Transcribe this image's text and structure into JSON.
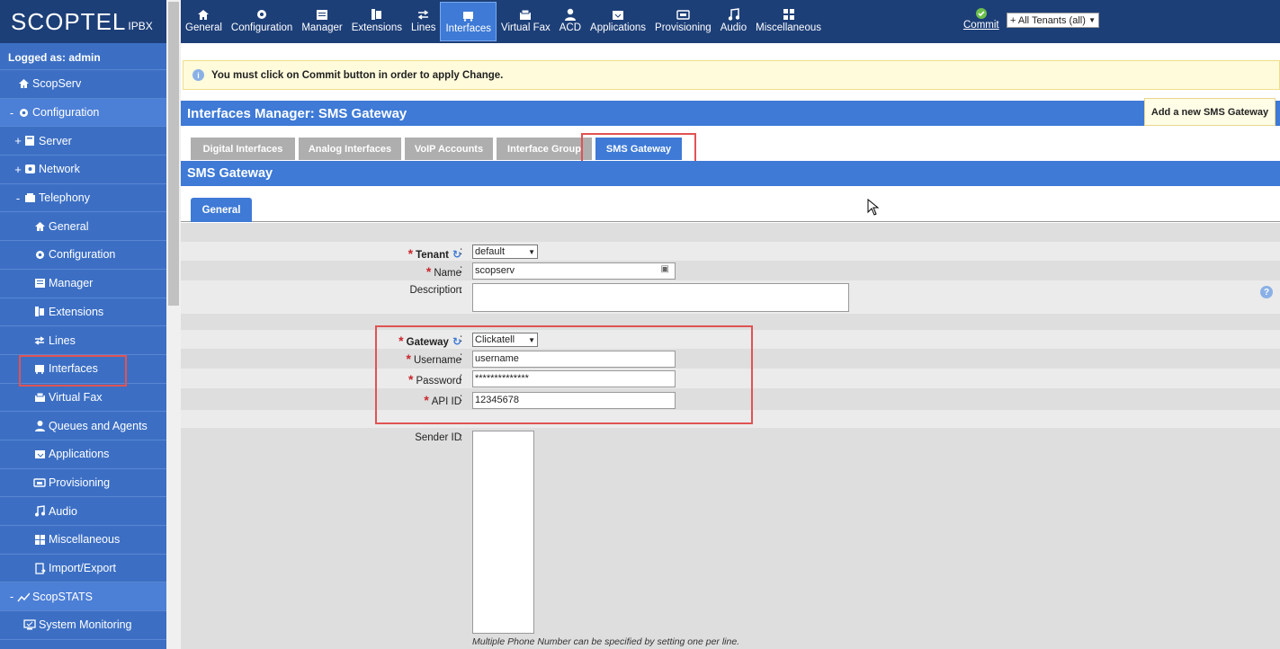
{
  "logo": {
    "main": "SCOPTEL",
    "sub": "IPBX"
  },
  "sidebar": {
    "logged_as": "Logged as: admin",
    "items": [
      {
        "label": "ScopServ",
        "icon": "home-icon",
        "pm": ""
      },
      {
        "label": "Configuration",
        "icon": "gear-icon",
        "pm": "-"
      },
      {
        "label": "Server",
        "icon": "server-icon",
        "pm": "+"
      },
      {
        "label": "Network",
        "icon": "network-icon",
        "pm": "+"
      },
      {
        "label": "Telephony",
        "icon": "telephony-icon",
        "pm": "-"
      },
      {
        "label": "General",
        "icon": "home-icon"
      },
      {
        "label": "Configuration",
        "icon": "gear-icon"
      },
      {
        "label": "Manager",
        "icon": "manager-icon"
      },
      {
        "label": "Extensions",
        "icon": "extensions-icon"
      },
      {
        "label": "Lines",
        "icon": "lines-icon"
      },
      {
        "label": "Interfaces",
        "icon": "interfaces-icon"
      },
      {
        "label": "Virtual Fax",
        "icon": "fax-icon"
      },
      {
        "label": "Queues and Agents",
        "icon": "agent-icon"
      },
      {
        "label": "Applications",
        "icon": "applications-icon"
      },
      {
        "label": "Provisioning",
        "icon": "provisioning-icon"
      },
      {
        "label": "Audio",
        "icon": "music-icon"
      },
      {
        "label": "Miscellaneous",
        "icon": "misc-icon"
      },
      {
        "label": "Import/Export",
        "icon": "import-export-icon"
      },
      {
        "label": "ScopSTATS",
        "icon": "stats-icon",
        "pm": "-"
      },
      {
        "label": "System Monitoring",
        "icon": "monitor-icon"
      }
    ]
  },
  "topbar": {
    "buttons": [
      "General",
      "Configuration",
      "Manager",
      "Extensions",
      "Lines",
      "Interfaces",
      "Virtual Fax",
      "ACD",
      "Applications",
      "Provisioning",
      "Audio",
      "Miscellaneous"
    ],
    "active": "Interfaces",
    "commit": "Commit",
    "tenant": "+ All Tenants (all)"
  },
  "notice": "You must click on Commit button in order to apply Change.",
  "header": {
    "title": "Interfaces Manager:  SMS Gateway",
    "add_button": "Add a new SMS Gateway"
  },
  "tabs": [
    "Digital Interfaces",
    "Analog Interfaces",
    "VoIP Accounts",
    "Interface Group",
    "SMS Gateway"
  ],
  "subheader": "SMS Gateway",
  "subtab": "General",
  "form": {
    "tenant": {
      "label": "Tenant",
      "value": "default"
    },
    "name": {
      "label": "Name",
      "value": "scopserv"
    },
    "description": {
      "label": "Description",
      "value": ""
    },
    "gateway": {
      "label": "Gateway",
      "value": "Clickatell"
    },
    "username": {
      "label": "Username",
      "value": "username"
    },
    "password": {
      "label": "Password",
      "value": "**************"
    },
    "api_id": {
      "label": "API ID",
      "value": "12345678"
    },
    "sender_id": {
      "label": "Sender ID",
      "value": ""
    },
    "sender_hint": "Multiple Phone Number can be specified by setting one per line."
  },
  "colors": {
    "sidebar": "#3c6fc4",
    "topbar": "#1d3f78",
    "accent": "#3e7ad6",
    "highlight": "#e05353"
  }
}
